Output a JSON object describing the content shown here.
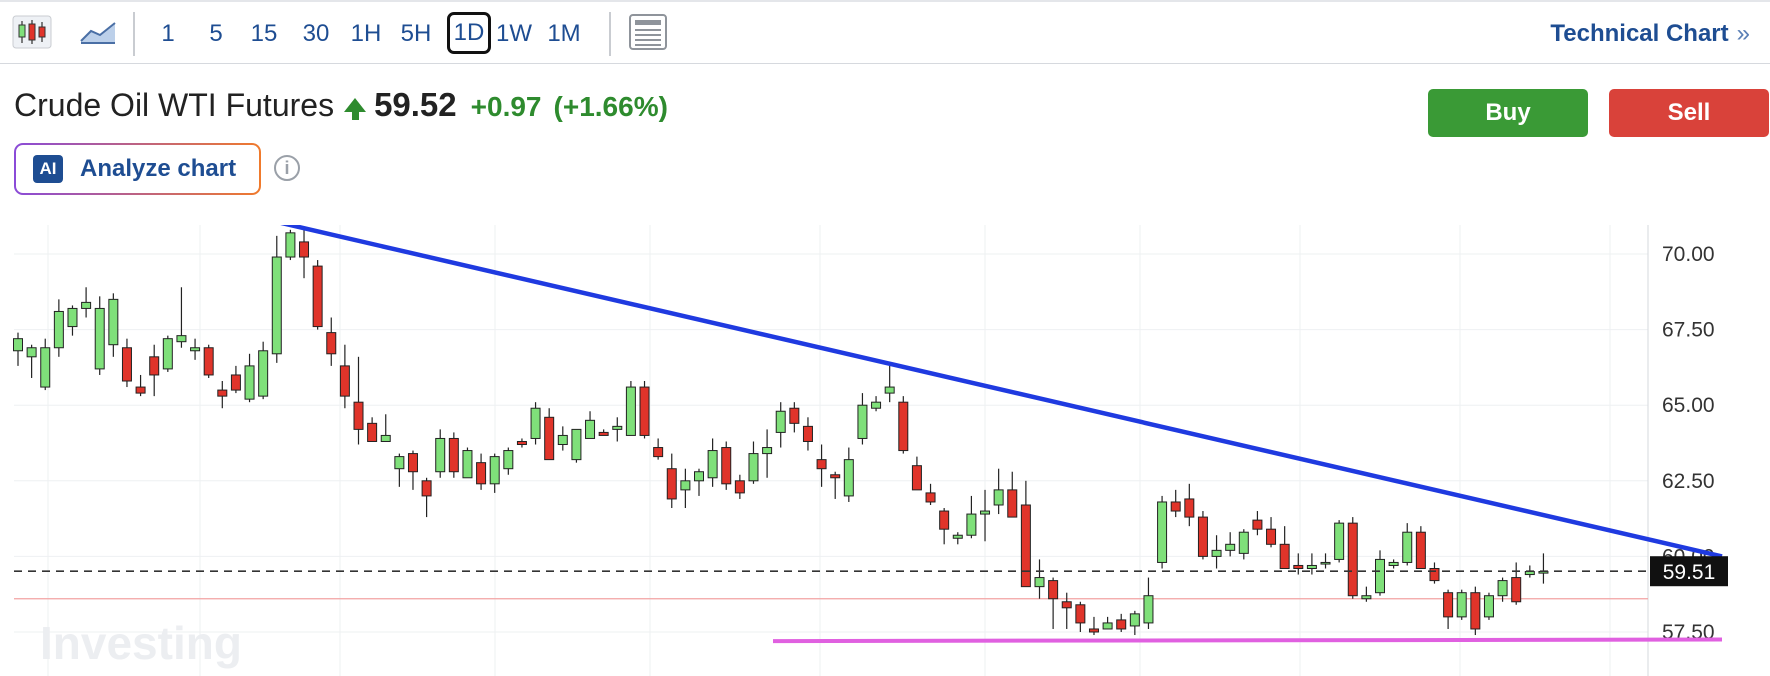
{
  "toolbar": {
    "icons": [
      "candlestick-icon",
      "area-chart-icon",
      "layout-icon"
    ],
    "timeframes": [
      "1",
      "5",
      "15",
      "30",
      "1H",
      "5H",
      "1D",
      "1W",
      "1M"
    ],
    "active_timeframe": "1D",
    "technical_chart_label": "Technical Chart",
    "technical_chart_chevron": "»"
  },
  "instrument": {
    "name": "Crude Oil WTI Futures",
    "price": "59.52",
    "change": "+0.97",
    "change_pct": "(+1.66%)",
    "direction": "up"
  },
  "actions": {
    "buy": "Buy",
    "sell": "Sell"
  },
  "analyze": {
    "badge": "AI",
    "label": "Analyze chart",
    "info": "i"
  },
  "colors": {
    "up": "#7fe07a",
    "down": "#e0342a",
    "trendline": "#1f3ae0",
    "support": "#e060e0",
    "brand_blue": "#1e4d92",
    "buy": "#3a9a36",
    "sell": "#d9423a"
  },
  "chart_data": {
    "type": "candlestick",
    "ylim": [
      57.0,
      72.4
    ],
    "y_ticks": [
      "70.00",
      "67.50",
      "65.00",
      "62.50",
      "60.00",
      "57.50"
    ],
    "current_price_label": "59.51",
    "current_price": 59.51,
    "reference_line": 58.6,
    "watermark": "Investing",
    "candles": [
      [
        66.8,
        67.4,
        66.3,
        67.2
      ],
      [
        66.6,
        67.0,
        65.9,
        66.9
      ],
      [
        65.6,
        67.2,
        65.5,
        66.9
      ],
      [
        66.9,
        68.5,
        66.6,
        68.1
      ],
      [
        67.6,
        68.3,
        67.3,
        68.2
      ],
      [
        68.2,
        68.9,
        67.9,
        68.4
      ],
      [
        66.2,
        68.6,
        66.0,
        68.2
      ],
      [
        67.0,
        68.7,
        66.6,
        68.5
      ],
      [
        66.9,
        67.2,
        65.6,
        65.8
      ],
      [
        65.6,
        66.0,
        65.3,
        65.4
      ],
      [
        66.6,
        67.0,
        65.3,
        66.0
      ],
      [
        66.2,
        67.3,
        66.1,
        67.2
      ],
      [
        67.1,
        68.9,
        66.9,
        67.3
      ],
      [
        66.8,
        67.2,
        66.5,
        66.9
      ],
      [
        66.9,
        67.0,
        65.9,
        66.0
      ],
      [
        65.5,
        65.8,
        64.9,
        65.3
      ],
      [
        66.0,
        66.3,
        65.4,
        65.5
      ],
      [
        65.2,
        66.7,
        65.1,
        66.3
      ],
      [
        65.3,
        67.1,
        65.2,
        66.8
      ],
      [
        66.7,
        70.6,
        66.4,
        69.9
      ],
      [
        69.9,
        70.8,
        69.8,
        70.7
      ],
      [
        70.4,
        70.8,
        69.2,
        69.9
      ],
      [
        69.6,
        69.8,
        67.5,
        67.6
      ],
      [
        67.4,
        67.9,
        66.3,
        66.7
      ],
      [
        66.3,
        67.0,
        64.9,
        65.3
      ],
      [
        65.1,
        66.6,
        63.7,
        64.2
      ],
      [
        64.4,
        64.6,
        63.9,
        63.8
      ],
      [
        63.8,
        64.7,
        63.8,
        64.0
      ],
      [
        62.9,
        63.4,
        62.3,
        63.3
      ],
      [
        63.4,
        63.5,
        62.2,
        62.8
      ],
      [
        62.5,
        62.6,
        61.3,
        62.0
      ],
      [
        62.8,
        64.2,
        62.6,
        63.9
      ],
      [
        63.9,
        64.1,
        62.6,
        62.8
      ],
      [
        62.6,
        63.6,
        62.6,
        63.5
      ],
      [
        63.1,
        63.4,
        62.2,
        62.4
      ],
      [
        62.4,
        63.4,
        62.1,
        63.3
      ],
      [
        62.9,
        63.6,
        62.7,
        63.5
      ],
      [
        63.8,
        63.9,
        63.6,
        63.7
      ],
      [
        63.9,
        65.1,
        63.7,
        64.9
      ],
      [
        64.6,
        64.9,
        63.2,
        63.2
      ],
      [
        63.7,
        64.3,
        63.5,
        64.0
      ],
      [
        63.2,
        64.1,
        63.1,
        64.2
      ],
      [
        63.9,
        64.8,
        63.9,
        64.5
      ],
      [
        64.1,
        64.2,
        64.0,
        64.0
      ],
      [
        64.2,
        64.6,
        63.8,
        64.3
      ],
      [
        64.0,
        65.8,
        64.0,
        65.6
      ],
      [
        65.6,
        65.8,
        63.9,
        64.0
      ],
      [
        63.6,
        63.9,
        63.2,
        63.3
      ],
      [
        62.9,
        63.4,
        61.6,
        61.9
      ],
      [
        62.2,
        62.9,
        61.6,
        62.5
      ],
      [
        62.5,
        62.9,
        62.0,
        62.8
      ],
      [
        62.6,
        63.9,
        62.3,
        63.5
      ],
      [
        63.6,
        63.8,
        62.2,
        62.4
      ],
      [
        62.5,
        62.7,
        61.9,
        62.1
      ],
      [
        62.5,
        63.8,
        62.4,
        63.4
      ],
      [
        63.4,
        64.2,
        62.6,
        63.6
      ],
      [
        64.1,
        65.1,
        63.6,
        64.8
      ],
      [
        64.9,
        65.1,
        64.1,
        64.4
      ],
      [
        64.3,
        64.6,
        63.5,
        63.8
      ],
      [
        63.2,
        63.7,
        62.3,
        62.9
      ],
      [
        62.7,
        62.8,
        61.9,
        62.6
      ],
      [
        62.0,
        63.6,
        61.8,
        63.2
      ],
      [
        63.9,
        65.4,
        63.7,
        65.0
      ],
      [
        64.9,
        65.3,
        64.8,
        65.1
      ],
      [
        65.4,
        66.4,
        65.1,
        65.6
      ],
      [
        65.1,
        65.3,
        63.4,
        63.5
      ],
      [
        63.0,
        63.3,
        62.2,
        62.2
      ],
      [
        62.1,
        62.4,
        61.7,
        61.8
      ],
      [
        61.5,
        61.6,
        60.4,
        60.9
      ],
      [
        60.6,
        60.8,
        60.4,
        60.7
      ],
      [
        60.7,
        62.0,
        60.6,
        61.4
      ],
      [
        61.4,
        62.2,
        60.5,
        61.5
      ],
      [
        61.7,
        62.9,
        61.4,
        62.2
      ],
      [
        62.2,
        62.8,
        61.6,
        61.3
      ],
      [
        61.7,
        62.5,
        59.8,
        59.0
      ],
      [
        59.0,
        59.9,
        58.6,
        59.3
      ],
      [
        59.2,
        59.3,
        57.6,
        58.6
      ],
      [
        58.5,
        58.8,
        57.6,
        58.3
      ],
      [
        58.4,
        58.5,
        57.5,
        57.8
      ],
      [
        57.6,
        58.0,
        57.4,
        57.5
      ],
      [
        57.6,
        58.0,
        57.6,
        57.8
      ],
      [
        57.9,
        58.1,
        57.5,
        57.6
      ],
      [
        57.7,
        58.2,
        57.4,
        58.1
      ],
      [
        57.8,
        59.3,
        57.6,
        58.7
      ],
      [
        59.8,
        62.0,
        59.6,
        61.8
      ],
      [
        61.8,
        62.2,
        61.3,
        61.5
      ],
      [
        61.9,
        62.4,
        61.0,
        61.3
      ],
      [
        61.3,
        61.5,
        59.9,
        60.0
      ],
      [
        60.0,
        60.7,
        59.6,
        60.2
      ],
      [
        60.2,
        60.8,
        60.0,
        60.4
      ],
      [
        60.1,
        60.9,
        59.9,
        60.8
      ],
      [
        61.2,
        61.5,
        60.7,
        60.9
      ],
      [
        60.9,
        61.3,
        60.3,
        60.4
      ],
      [
        60.4,
        61.0,
        59.8,
        59.6
      ],
      [
        59.7,
        60.1,
        59.4,
        59.6
      ],
      [
        59.6,
        60.1,
        59.4,
        59.7
      ],
      [
        59.8,
        60.1,
        59.6,
        59.8
      ],
      [
        59.9,
        61.2,
        59.8,
        61.1
      ],
      [
        61.1,
        61.3,
        58.6,
        58.7
      ],
      [
        58.6,
        59.0,
        58.5,
        58.7
      ],
      [
        58.8,
        60.2,
        58.7,
        59.9
      ],
      [
        59.7,
        59.9,
        59.6,
        59.8
      ],
      [
        59.8,
        61.1,
        59.7,
        60.8
      ],
      [
        60.8,
        61.0,
        59.6,
        59.6
      ],
      [
        59.6,
        59.8,
        59.1,
        59.2
      ],
      [
        58.8,
        58.9,
        57.6,
        58.0
      ],
      [
        58.0,
        58.9,
        57.9,
        58.8
      ],
      [
        58.8,
        59.0,
        57.4,
        57.6
      ],
      [
        58.0,
        58.8,
        57.9,
        58.7
      ],
      [
        58.7,
        59.3,
        58.5,
        59.2
      ],
      [
        59.3,
        59.8,
        58.4,
        58.5
      ],
      [
        59.4,
        59.7,
        59.3,
        59.5
      ],
      [
        59.5,
        60.1,
        59.1,
        59.5
      ]
    ],
    "trendline": {
      "from": [
        19,
        71.1
      ],
      "to": [
        114,
        60.0
      ]
    },
    "support": {
      "from": [
        54,
        57.2
      ],
      "to": [
        114,
        57.25
      ]
    }
  }
}
